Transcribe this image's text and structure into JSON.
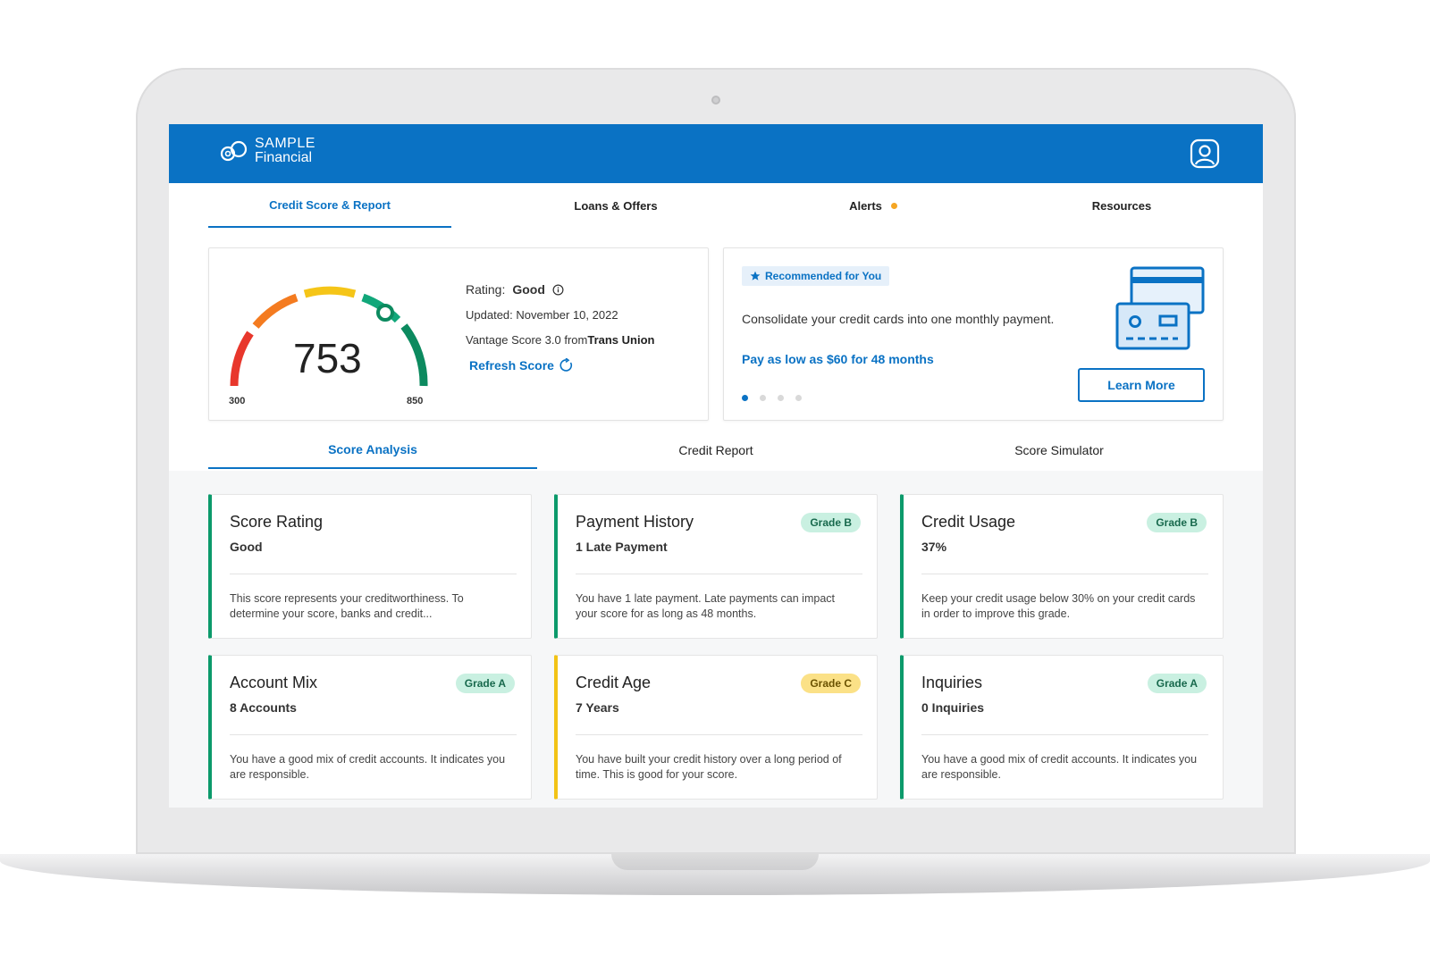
{
  "brand": {
    "line1": "SAMPLE",
    "line2": "Financial"
  },
  "colors": {
    "primary": "#0a72c4",
    "green": "#0c9a6b",
    "yellow": "#f2c316",
    "alert": "#f5a623"
  },
  "nav": {
    "items": [
      {
        "label": "Credit Score & Report"
      },
      {
        "label": "Loans & Offers"
      },
      {
        "label": "Alerts"
      },
      {
        "label": "Resources"
      }
    ]
  },
  "score": {
    "value": "753",
    "min": "300",
    "max": "850",
    "rating_label": "Rating:",
    "rating_value": "Good",
    "updated": "Updated: November 10, 2022",
    "source_prefix": "Vantage Score 3.0 from",
    "source_bureau": "Trans Union",
    "refresh_label": "Refresh Score"
  },
  "promo": {
    "badge": "Recommended for You",
    "text": "Consolidate your credit cards into one monthly payment.",
    "link": "Pay as low as $60 for 48 months",
    "button": "Learn More"
  },
  "sub_tabs": [
    {
      "label": "Score Analysis"
    },
    {
      "label": "Credit Report"
    },
    {
      "label": "Score Simulator"
    }
  ],
  "tiles": [
    {
      "title": "Score Rating",
      "sub": "Good",
      "grade": "",
      "desc": "This score represents your creditworthiness. To determine your score, banks and credit..."
    },
    {
      "title": "Payment History",
      "sub": "1 Late Payment",
      "grade": "Grade B",
      "desc": "You have 1 late payment. Late payments can impact your score for as long as 48 months."
    },
    {
      "title": "Credit Usage",
      "sub": "37%",
      "grade": "Grade B",
      "desc": "Keep your credit usage below 30% on your credit cards in order to improve this grade."
    },
    {
      "title": "Account Mix",
      "sub": "8 Accounts",
      "grade": "Grade A",
      "desc": "You have a good mix of credit accounts. It indicates you are responsible."
    },
    {
      "title": "Credit Age",
      "sub": "7 Years",
      "grade": "Grade C",
      "desc": "You have built your credit history over a long period of time. This is good for your score."
    },
    {
      "title": "Inquiries",
      "sub": "0 Inquiries",
      "grade": "Grade A",
      "desc": "You have a good mix of credit accounts. It indicates you are responsible."
    }
  ]
}
